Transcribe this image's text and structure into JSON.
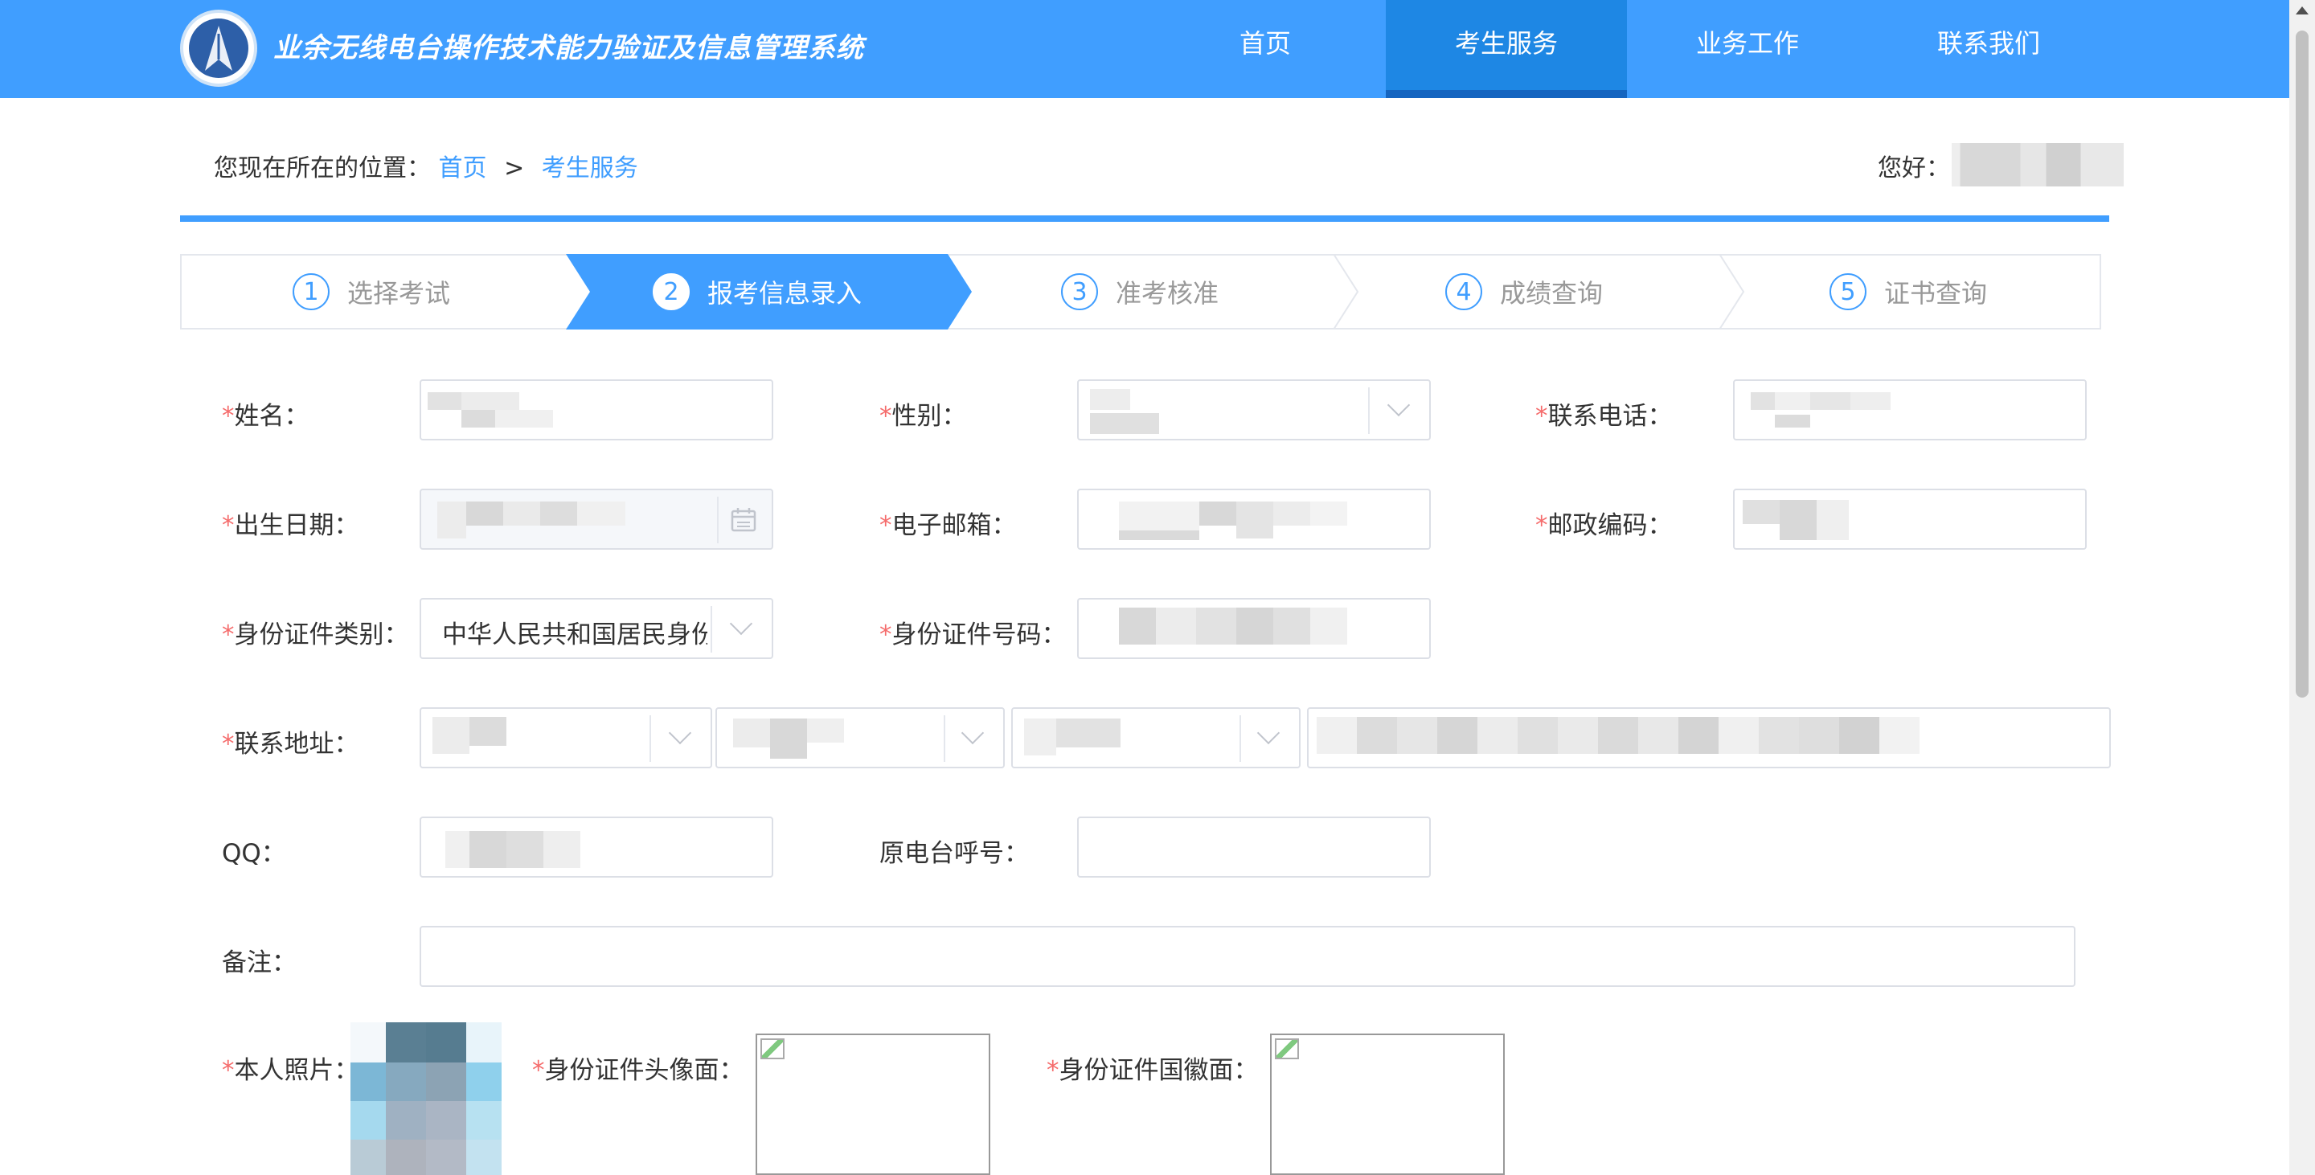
{
  "header": {
    "title": "业余无线电台操作技术能力验证及信息管理系统",
    "nav": [
      {
        "label": "首页",
        "active": false
      },
      {
        "label": "考生服务",
        "active": true
      },
      {
        "label": "业务工作",
        "active": false
      },
      {
        "label": "联系我们",
        "active": false
      }
    ]
  },
  "breadcrumb": {
    "prefix": "您现在所在的位置：",
    "home": "首页",
    "separator": ">",
    "current": "考生服务"
  },
  "user": {
    "greeting": "您好："
  },
  "steps": [
    {
      "num": "1",
      "label": "选择考试"
    },
    {
      "num": "2",
      "label": "报考信息录入"
    },
    {
      "num": "3",
      "label": "准考核准"
    },
    {
      "num": "4",
      "label": "成绩查询"
    },
    {
      "num": "5",
      "label": "证书查询"
    }
  ],
  "form": {
    "required_mark": "*",
    "name_label": "姓名：",
    "gender_label": "性别：",
    "phone_label": "联系电话：",
    "birth_label": "出生日期：",
    "email_label": "电子邮箱：",
    "zip_label": "邮政编码：",
    "id_type_label": "身份证件类别：",
    "id_type_value": "中华人民共和国居民身份",
    "id_number_label": "身份证件号码：",
    "address_label": "联系地址：",
    "qq_label": "QQ：",
    "callsign_label": "原电台呼号：",
    "remark_label": "备注：",
    "photo_label": "本人照片：",
    "id_front_label": "身份证件头像面：",
    "id_back_label": "身份证件国徽面："
  },
  "colors": {
    "primary": "#409eff",
    "required": "#f56c6c"
  },
  "icons": [
    "logo-icon",
    "calendar-icon",
    "chevron-down-icon",
    "broken-image-icon"
  ]
}
